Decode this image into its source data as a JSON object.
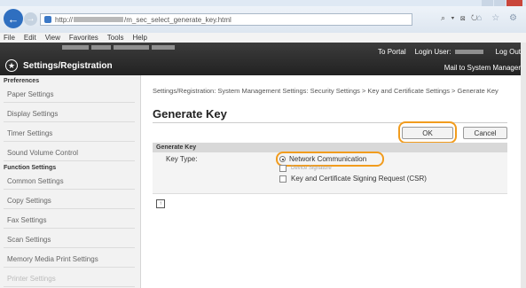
{
  "browser": {
    "url_scheme": "http://",
    "url_path": "/m_sec_select_generate_key.html",
    "search_controls": "⌕ ▾ ⊠ ↻",
    "home_controls": "⌂ ☆ ⚙",
    "menu": [
      "File",
      "Edit",
      "View",
      "Favorites",
      "Tools",
      "Help"
    ]
  },
  "app": {
    "title": "Settings/Registration",
    "to_portal": "To Portal",
    "login_user_label": "Login User:",
    "log_out": "Log Out",
    "mail_to_admin": "Mail to System Manager"
  },
  "sidebar": {
    "preferences_head": "Preferences",
    "preferences": [
      "Paper Settings",
      "Display Settings",
      "Timer Settings",
      "Sound Volume Control"
    ],
    "function_head": "Function Settings",
    "function": [
      "Common Settings",
      "Copy Settings",
      "Fax Settings",
      "Scan Settings",
      "Memory Media Print Settings",
      "Printer Settings"
    ]
  },
  "main": {
    "breadcrumb": "Settings/Registration: System Management Settings: Security Settings > Key and Certificate Settings > Generate Key",
    "page_title": "Generate Key",
    "ok_label": "OK",
    "cancel_label": "Cancel",
    "section_title": "Generate Key",
    "key_type_label": "Key Type:",
    "options": [
      "Network Communication",
      "Device Signature",
      "Key and Certificate Signing Request (CSR)"
    ],
    "selected_option": "Network Communication",
    "to_top_icon": "↑"
  },
  "colors": {
    "highlight_ring": "#f19c1e",
    "header_bg": "#2b2b2b",
    "back_button": "#2f6fc0"
  }
}
